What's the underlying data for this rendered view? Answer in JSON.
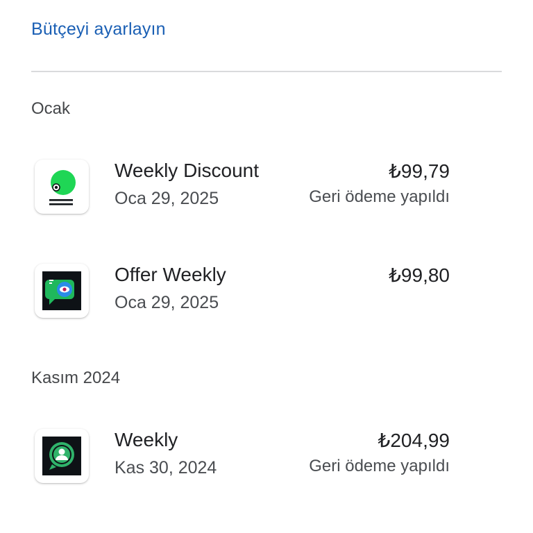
{
  "header": {
    "budget_link": "Bütçeyi ayarlayın"
  },
  "sections": [
    {
      "title": "Ocak",
      "items": [
        {
          "icon": "weekly-discount-app-icon",
          "name": "Weekly Discount",
          "date": "Oca 29, 2025",
          "price": "₺99,79",
          "status": "Geri ödeme yapıldı"
        },
        {
          "icon": "offer-weekly-app-icon",
          "name": "Offer Weekly",
          "date": "Oca 29, 2025",
          "price": "₺99,80",
          "status": ""
        }
      ]
    },
    {
      "title": "Kasım 2024",
      "items": [
        {
          "icon": "weekly-app-icon",
          "name": "Weekly",
          "date": "Kas 30, 2024",
          "price": "₺204,99",
          "status": "Geri ödeme yapıldı"
        }
      ]
    }
  ],
  "colors": {
    "link": "#1a5fb4",
    "divider": "#d9dadc",
    "primary_text": "#202124",
    "secondary_text": "#4a4d51",
    "icon1_green": "#1fd655",
    "icon_dark_bg": "#0e1216",
    "icon3_green": "#2fb36a"
  }
}
